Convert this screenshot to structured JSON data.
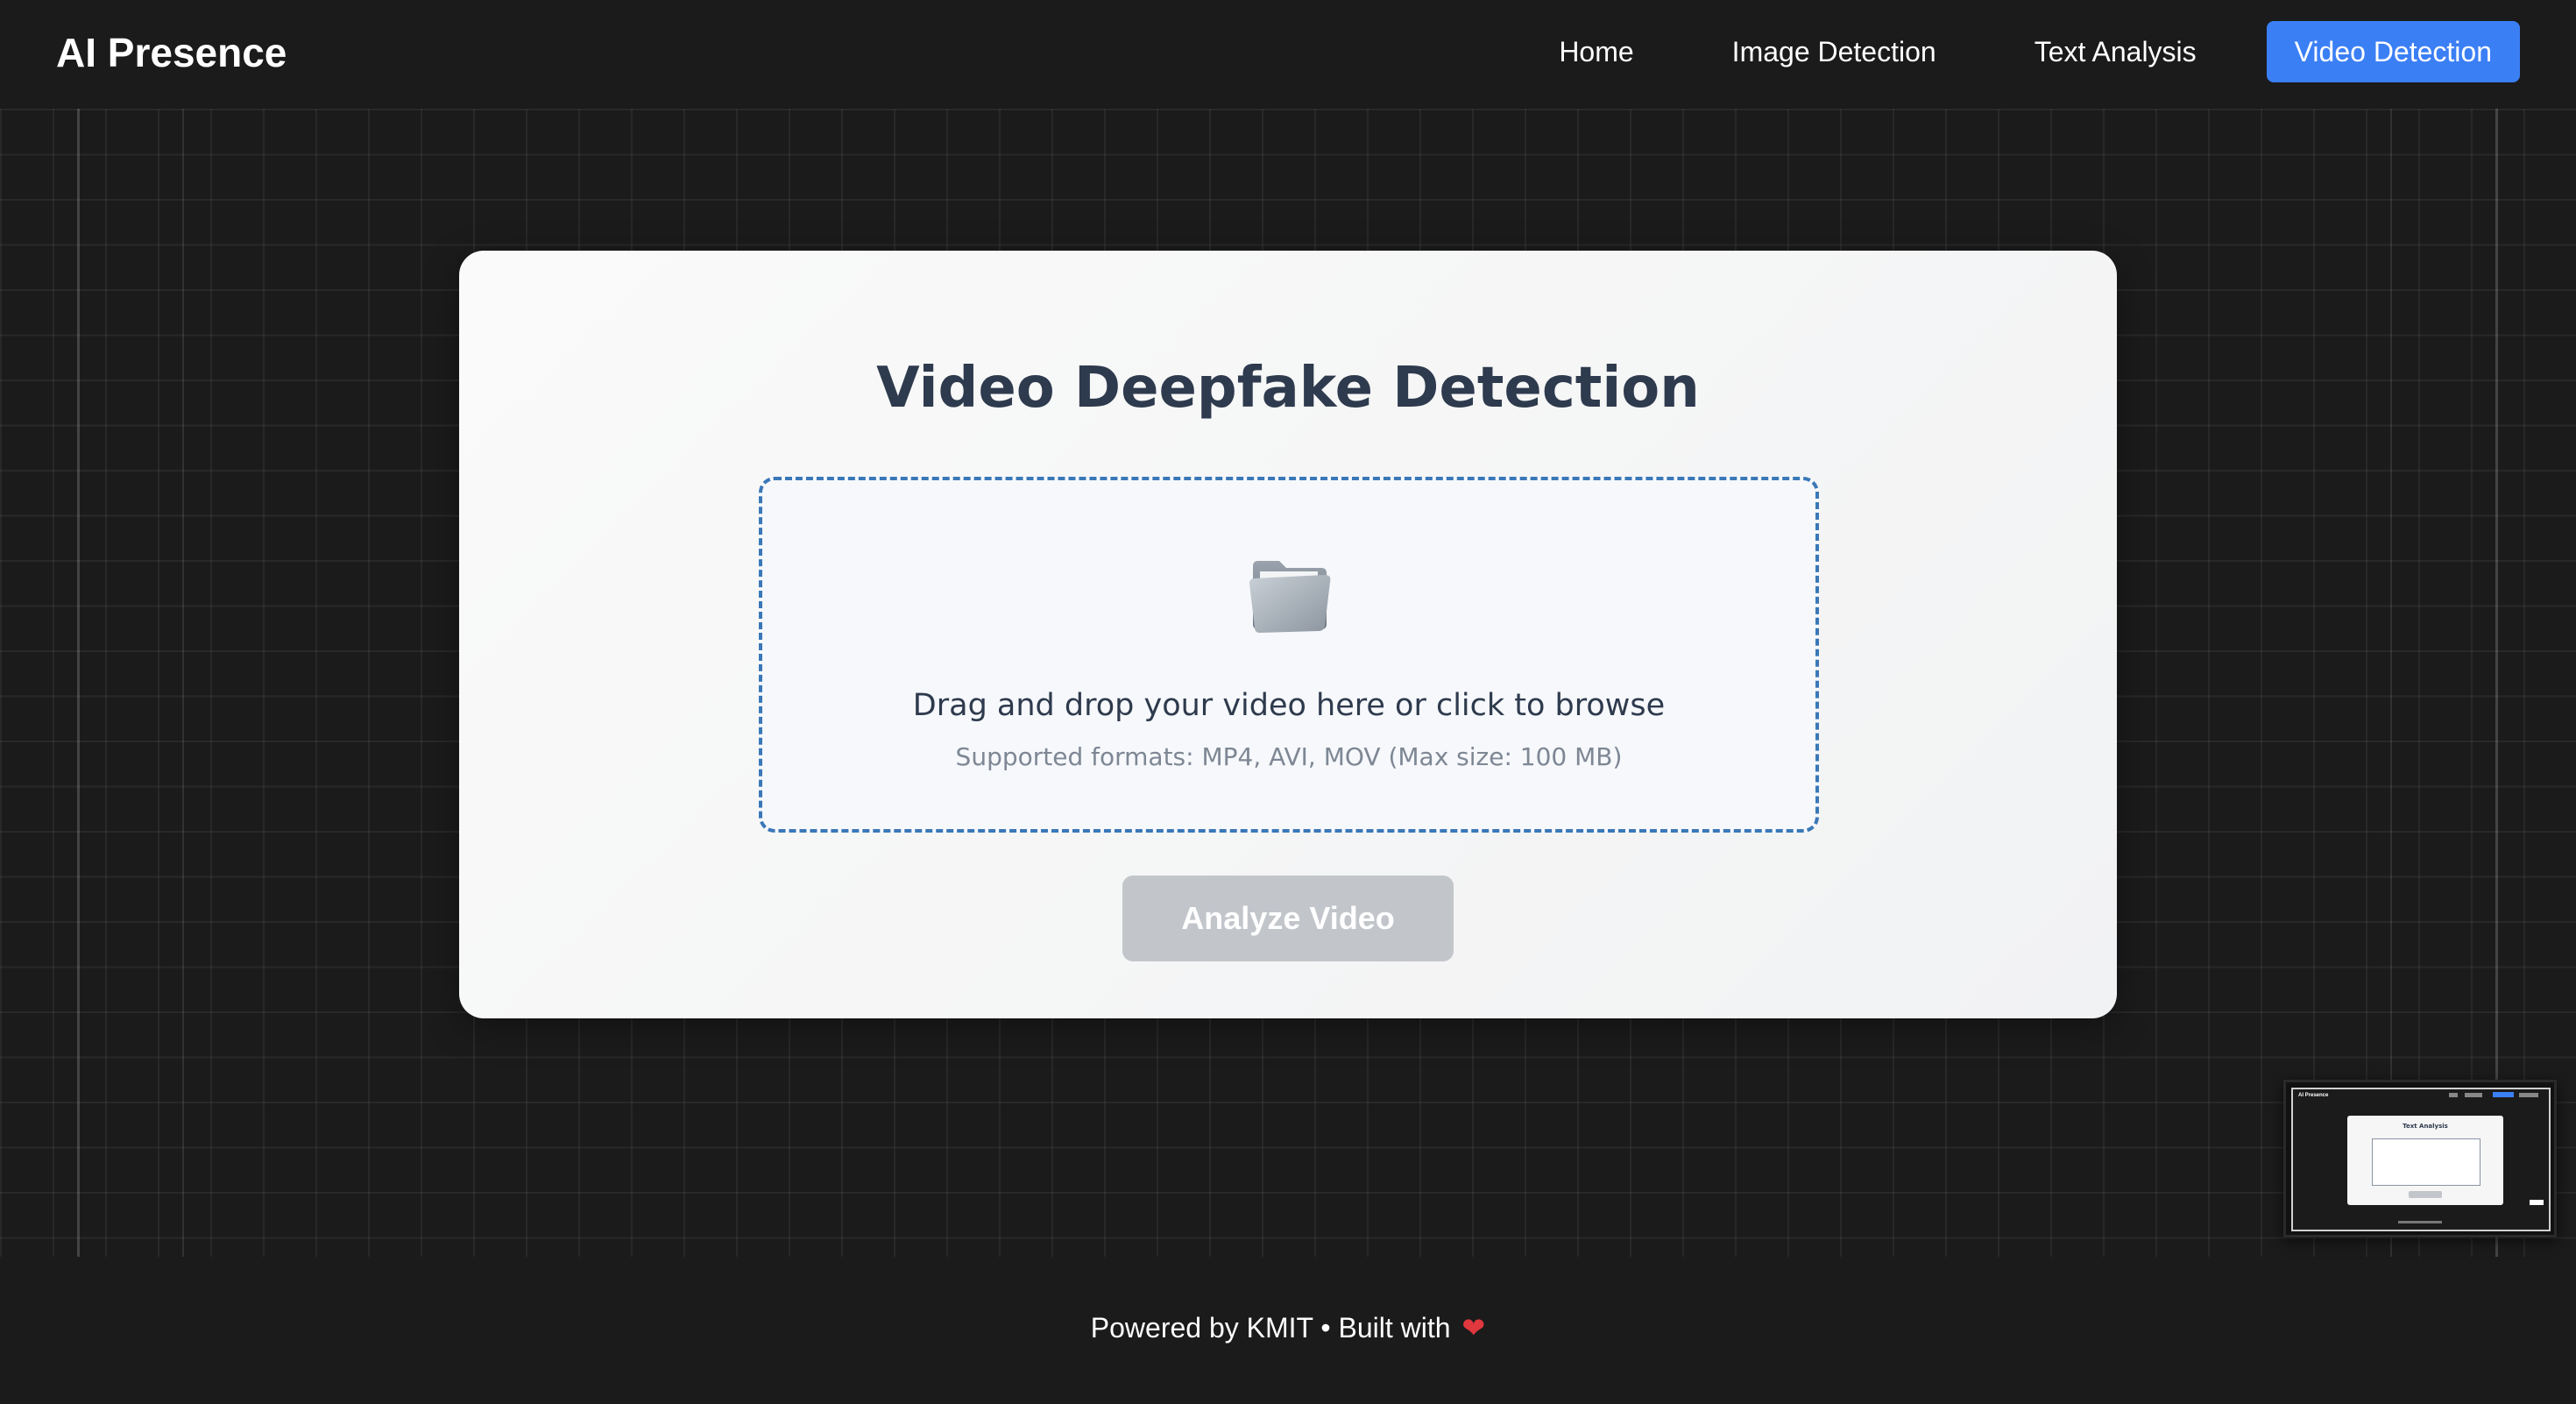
{
  "header": {
    "brand": "AI Presence",
    "nav": [
      {
        "label": "Home",
        "active": false
      },
      {
        "label": "Image Detection",
        "active": false
      },
      {
        "label": "Text Analysis",
        "active": false
      },
      {
        "label": "Video Detection",
        "active": true
      }
    ]
  },
  "card": {
    "title": "Video Deepfake Detection",
    "dropzone": {
      "icon": "folder-icon",
      "text": "Drag and drop your video here or click to browse",
      "hint": "Supported formats: MP4, AVI, MOV (Max size: 100 MB)"
    },
    "analyze_button": "Analyze Video"
  },
  "thumbnail": {
    "brand": "AI Presence",
    "card_title": "Text Analysis"
  },
  "footer": {
    "text": "Powered by KMIT • Built with",
    "icon": "heart-icon",
    "heart": "❤"
  },
  "colors": {
    "background": "#1b1b1b",
    "accent": "#3b7ff5",
    "title": "#2e3a4d",
    "dropzone_border": "#3a78b8",
    "button_disabled": "#c2c6cb",
    "heart": "#e0383e"
  }
}
